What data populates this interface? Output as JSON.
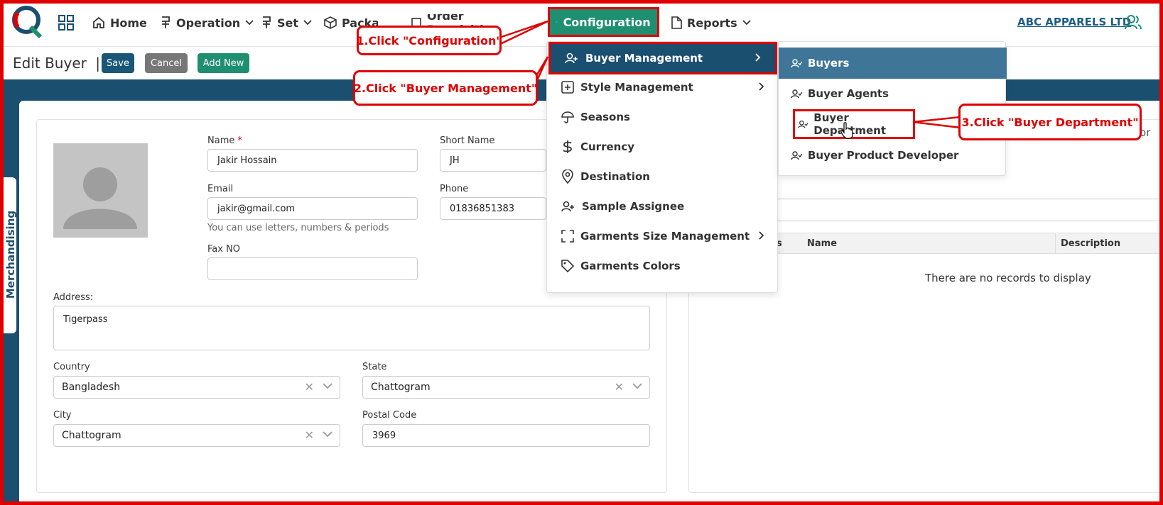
{
  "nav": {
    "items": [
      {
        "label": "Home"
      },
      {
        "label": "Operation"
      },
      {
        "label": "Set"
      },
      {
        "label": "Packaging"
      },
      {
        "label": "Order Requisition"
      },
      {
        "label": "Configuration"
      },
      {
        "label": "Reports"
      }
    ],
    "company": "ABC APPARELS LTD"
  },
  "header": {
    "title": "Edit Buyer",
    "separator": "|",
    "save_label": "Save",
    "cancel_label": "Cancel",
    "add_new_label": "Add New"
  },
  "side_tab": "Merchandising",
  "form": {
    "name_label": "Name",
    "name_required": "*",
    "name_value": "Jakir Hossain",
    "short_name_label": "Short Name",
    "short_name_value": "JH",
    "email_label": "Email",
    "email_value": "jakir@gmail.com",
    "email_hint": "You can use letters, numbers & periods",
    "phone_label": "Phone",
    "phone_value": "01836851383",
    "fax_label": "Fax NO",
    "fax_value": "",
    "address_label": "Address:",
    "address_value": "Tigerpass",
    "country_label": "Country",
    "country_value": "Bangladesh",
    "state_label": "State",
    "state_value": "Chattogram",
    "city_label": "City",
    "city_value": "Chattogram",
    "postal_label": "Postal Code",
    "postal_value": "3969"
  },
  "table": {
    "col_partial": "s",
    "col_name": "Name",
    "col_description": "Description",
    "empty_text": "There are no records to display",
    "partial_label": "or"
  },
  "menu": {
    "items": [
      {
        "label": "Buyer Management",
        "icon": "user-plus-icon"
      },
      {
        "label": "Style Management",
        "icon": "plus-square-icon"
      },
      {
        "label": "Seasons",
        "icon": "umbrella-icon"
      },
      {
        "label": "Currency",
        "icon": "dollar-icon"
      },
      {
        "label": "Destination",
        "icon": "map-pin-icon"
      },
      {
        "label": "Sample Assignee",
        "icon": "user-plus-icon"
      },
      {
        "label": "Garments Size Management",
        "icon": "frame-icon"
      },
      {
        "label": "Garments Colors",
        "icon": "tag-icon"
      }
    ]
  },
  "submenu": {
    "items": [
      {
        "label": "Buyers"
      },
      {
        "label": "Buyer Agents"
      },
      {
        "label": "Buyer Department"
      },
      {
        "label": "Buyer Product Developer"
      }
    ]
  },
  "callouts": {
    "step1": "1.Click \"Configuration\"",
    "step2": "2.Click \"Buyer Management\"",
    "step3": "3.Click \"Buyer Department\""
  },
  "colors": {
    "brand_dark": "#1b4f70",
    "brand_green": "#1f8f72",
    "annotation_red": "#e00000"
  }
}
